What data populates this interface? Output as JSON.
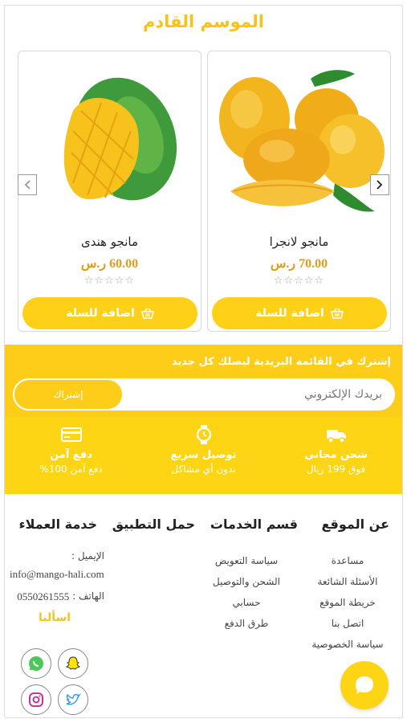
{
  "section": {
    "title": "الموسم القادم"
  },
  "products": [
    {
      "name": "مانجو لانجرا",
      "price": "70.00 ر.س",
      "rating": 0,
      "stars": "☆☆☆☆☆",
      "add_label": "اضافة للسلة"
    },
    {
      "name": "مانجو هندى",
      "price": "60.00 ر.س",
      "rating": 0,
      "stars": "☆☆☆☆☆",
      "add_label": "اضافة للسلة"
    }
  ],
  "carousel": {
    "next_icon": "chevron-right",
    "prev_icon": "chevron-left"
  },
  "newsletter": {
    "text": "إشترك في القائمة البريدية ليصلك كل جديد",
    "placeholder": "بريدك الإلكتروني",
    "button": "إشتراك"
  },
  "features": [
    {
      "title": "شحن مجاني",
      "subtitle": "فوق 199 ريال",
      "icon": "truck"
    },
    {
      "title": "توصيل سريع",
      "subtitle": "بدون أي مشاكل",
      "icon": "watch"
    },
    {
      "title": "دفع آمن",
      "subtitle": "دفع آمن 100%",
      "icon": "credit-card"
    }
  ],
  "footer": {
    "about": {
      "title": "عن الموقع",
      "items": [
        "مساعدة",
        "الأسئلة الشائعة",
        "خريطة الموقع",
        "اتصل بنا",
        "سياسة الخصوصية"
      ]
    },
    "services": {
      "title": "قسم الخدمات",
      "items": [
        "سياسة التعويض",
        "الشحن والتوصيل",
        "حسابي",
        "طرق الدفع"
      ]
    },
    "app": {
      "title": "حمل التطبيق"
    },
    "support": {
      "title": "خدمة العملاء",
      "email_label": "الإيميل :",
      "email": "info@mango-hali.com",
      "phone_label": "الهاتف :",
      "phone": "0550261555",
      "ask": "اسألنا"
    }
  },
  "social": [
    "whatsapp",
    "snapchat",
    "instagram",
    "twitter"
  ],
  "colors": {
    "accent": "#fed018",
    "price": "#e39b1b",
    "title": "#f6c31a"
  }
}
